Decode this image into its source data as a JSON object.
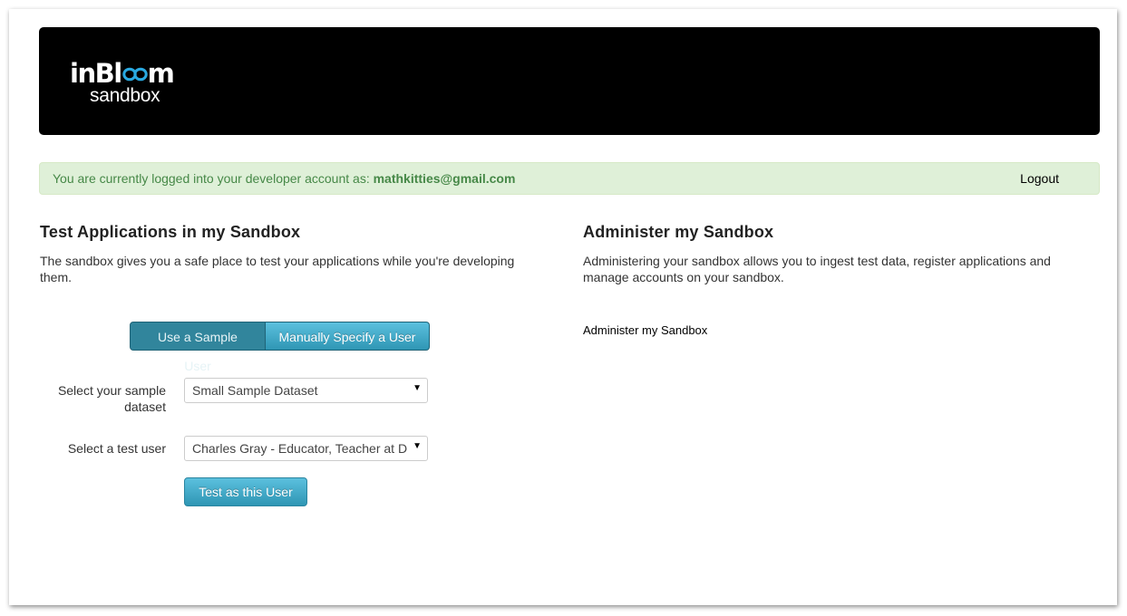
{
  "header": {
    "logo_top_left": "inBl",
    "logo_top_right": "m",
    "logo_bottom": "sandbox",
    "logo_accent_color": "#29a9e1"
  },
  "alert": {
    "message": "You are currently logged into your developer account as: ",
    "email": "mathkitties@gmail.com",
    "logout_label": "Logout"
  },
  "test_section": {
    "title": "Test Applications in my Sandbox",
    "description": "The sandbox gives you a safe place to test your applications while you're developing them.",
    "tabs": {
      "sample_user": "Use a Sample User",
      "manual_user": "Manually Specify a User"
    },
    "dataset_label": "Select your sample dataset",
    "dataset_value": "Small Sample Dataset",
    "user_label": "Select a test user",
    "user_value": "Charles Gray - Educator, Teacher at Daybreak",
    "test_button": "Test as this User"
  },
  "admin_section": {
    "title": "Administer my Sandbox",
    "description": "Administering your sandbox allows you to ingest test data, register applications and manage accounts on your sandbox.",
    "link": "Administer my Sandbox"
  }
}
